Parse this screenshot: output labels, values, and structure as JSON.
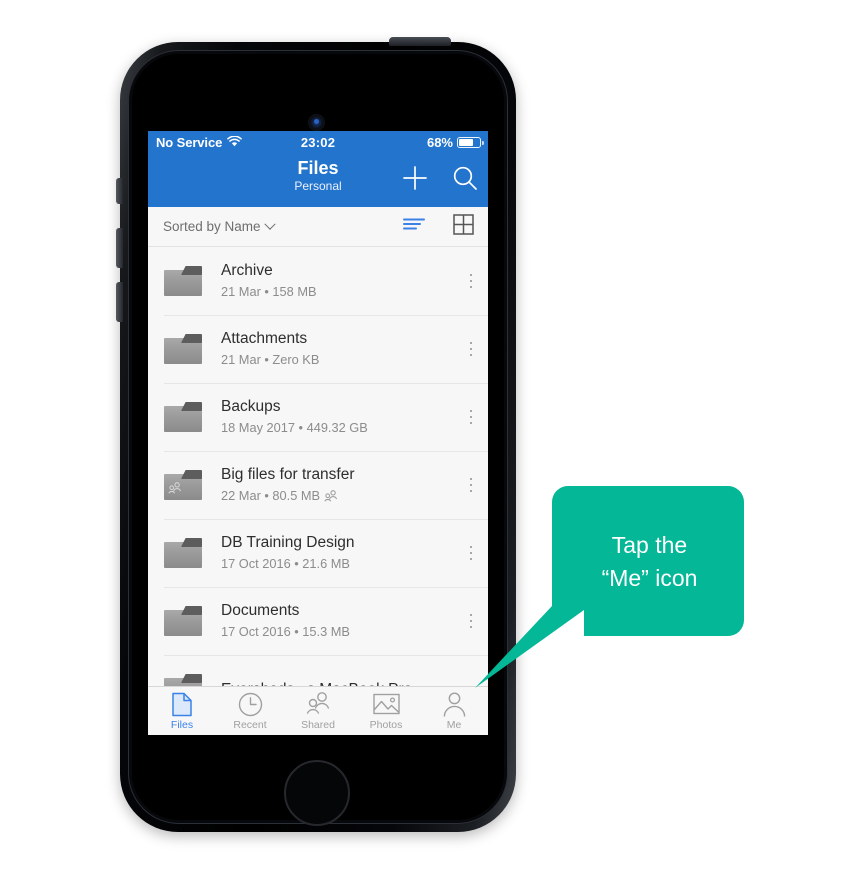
{
  "status_bar": {
    "carrier": "No Service",
    "wifi_icon": "wifi-icon",
    "time": "23:02",
    "battery_percent": "68%",
    "battery_level": 62
  },
  "nav_bar": {
    "title": "Files",
    "subtitle": "Personal",
    "add_icon": "plus-icon",
    "search_icon": "search-icon"
  },
  "sort_bar": {
    "label": "Sorted by Name",
    "chevron_icon": "chevron-down-icon",
    "list_view_icon": "list-view-icon",
    "grid_view_icon": "grid-view-icon"
  },
  "files": [
    {
      "name": "Archive",
      "meta": "21 Mar • 158 MB",
      "shared": false
    },
    {
      "name": "Attachments",
      "meta": "21 Mar • Zero KB",
      "shared": false
    },
    {
      "name": "Backups",
      "meta": "18 May 2017 • 449.32 GB",
      "shared": false
    },
    {
      "name": "Big files for transfer",
      "meta": "22 Mar • 80.5 MB",
      "shared": true
    },
    {
      "name": "DB Training Design",
      "meta": "17 Oct 2016 • 21.6 MB",
      "shared": false
    },
    {
      "name": "Documents",
      "meta": "17 Oct 2016 • 15.3 MB",
      "shared": false
    },
    {
      "name": "Eversheds...s MacBook Pro",
      "meta": "",
      "shared": false
    }
  ],
  "tab_bar": {
    "tabs": [
      {
        "label": "Files",
        "icon": "document-icon",
        "active": true
      },
      {
        "label": "Recent",
        "icon": "clock-icon",
        "active": false
      },
      {
        "label": "Shared",
        "icon": "people-icon",
        "active": false
      },
      {
        "label": "Photos",
        "icon": "photo-icon",
        "active": false
      },
      {
        "label": "Me",
        "icon": "person-icon",
        "active": false
      }
    ]
  },
  "callout": {
    "line1": "Tap the",
    "line2": "“Me” icon",
    "color": "#04b796"
  },
  "colors": {
    "header_blue": "#2374cd",
    "accent_blue": "#3b82e8",
    "screen_bg": "#f7f7f7",
    "callout_teal": "#04b796"
  }
}
